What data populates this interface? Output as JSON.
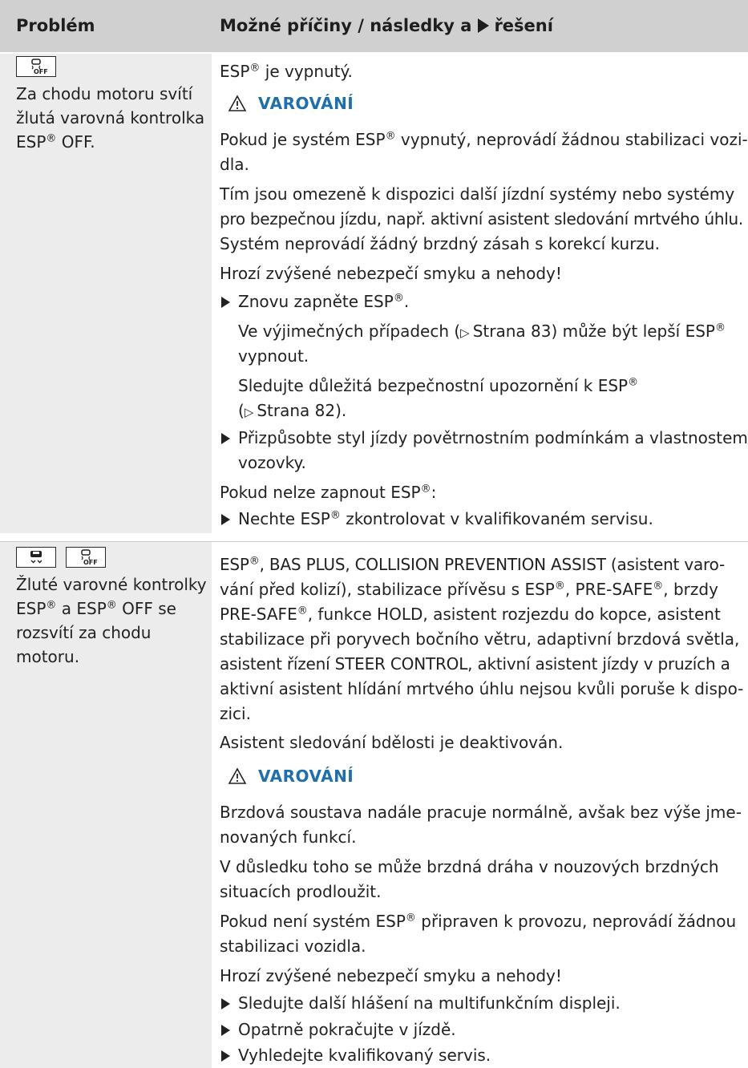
{
  "header": {
    "col1": "Problém",
    "col2a": "Možné příčiny / následky a",
    "col2b": "řešení"
  },
  "icons": [
    "esp-off-icon",
    "esp-icon"
  ],
  "row1": {
    "left": {
      "l1": "Za chodu motoru svítí",
      "l2": "žlutá varovná kontrolka",
      "l3": "ESP",
      "l3b": " OFF."
    },
    "right": {
      "esp_off_a": "ESP",
      "esp_off_b": " je vypnutý.",
      "warning_label": "VAROVÁNÍ",
      "p1a": "Pokud je systém ESP",
      "p1b": " vypnutý, neprovádí žádnou stabilizaci vozi-",
      "p1c": "dla.",
      "p2a": "Tím jsou omezeně k dispozici další jízdní systémy nebo systémy",
      "p2b": "pro bezpečnou jízdu, např. aktivní asistent sledování mrtvého úhlu.",
      "p2c": "Systém neprovádí žádný brzdný zásah s korekcí kurzu.",
      "p3": "Hrozí zvýšené nebezpečí smyku a nehody!",
      "b1a": "Znovu zapněte ESP",
      "b1b": ".",
      "s1a": "Ve výjimečných případech (",
      "s1ref": "Strana 83",
      "s1b": ") může být lepší ESP",
      "s1c": "vypnout.",
      "s2a": "Sledujte důležitá bezpečnostní upozornění k ESP",
      "s2b": "(",
      "s2ref": "Strana 82",
      "s2c": ").",
      "b2a": "Přizpůsobte styl jízdy povětrnostním podmínkám a vlastnostem",
      "b2b": "vozovky.",
      "p4a": "Pokud nelze zapnout ESP",
      "p4b": ":",
      "b3a": "Nechte ESP",
      "b3b": " zkontrolovat v kvalifikovaném servisu."
    }
  },
  "row2": {
    "left": {
      "l1": "Žluté varovné kontrolky",
      "l2a": "ESP",
      "l2b": " a ESP",
      "l2c": " OFF se",
      "l3": "rozsvítí za chodu",
      "l4": "motoru."
    },
    "right": {
      "a1a": "ESP",
      "a1b": ", BAS PLUS, COLLISION PREVENTION ASSIST (asistent varo-",
      "a2a": "vání před kolizí), stabilizace přívěsu s ESP",
      "a2b": ", PRE-SAFE",
      "a2c": ", brzdy",
      "a3a": "PRE-SAFE",
      "a3b": ", funkce HOLD, asistent rozjezdu do kopce, asistent",
      "a4": "stabilizace při poryvech bočního větru, adaptivní brzdová světla,",
      "a5": "asistent řízení STEER CONTROL, aktivní asistent jízdy v pruzích a",
      "a6": "aktivní asistent hlídání mrtvého úhlu nejsou kvůli poruše k dispo-",
      "a7": "zici.",
      "a8": "Asistent sledování bdělosti je deaktivován.",
      "warning_label": "VAROVÁNÍ",
      "w1": "Brzdová soustava nadále pracuje normálně, avšak bez výše jme-",
      "w2": "novaných funkcí.",
      "w3": "V důsledku toho se může brzdná dráha v nouzových brzdných",
      "w4": "situacích prodloužit.",
      "w5a": "Pokud není systém ESP",
      "w5b": " připraven k provozu, neprovádí žádnou",
      "w6": "stabilizaci vozidla.",
      "w7": "Hrozí zvýšené nebezpečí smyku a nehody!",
      "b1": "Sledujte další hlášení na multifunkčním displeji.",
      "b2": "Opatrně pokračujte v jízdě.",
      "b3": "Vyhledejte kvalifikovaný servis."
    }
  },
  "reg": "®",
  "ref_arrow": "▷"
}
